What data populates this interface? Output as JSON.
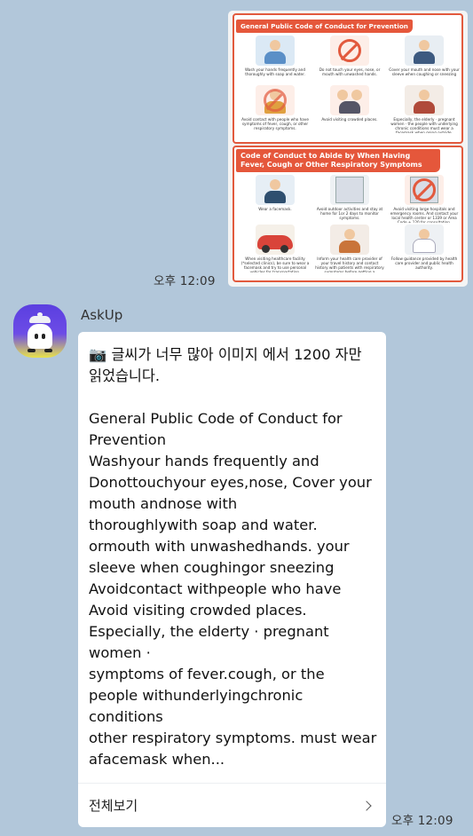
{
  "sent_image": {
    "panel1_title": "General Public Code of Conduct for Prevention",
    "panel1_captions": [
      "Wash your hands frequently and thoroughly with soap and water.",
      "Do not touch your eyes, nose, or mouth with unwashed hands.",
      "Cover your mouth and nose with your sleeve when coughing or sneezing",
      "Avoid contact with people who have symptoms of fever, cough, or other respiratory symptoms.",
      "Avoid visiting crowded places.",
      "Especially, the elderly · pregnant women · the people with underlying chronic conditions must wear a facemask when going outside."
    ],
    "panel2_title": "Code of Conduct to Abide by When Having Fever, Cough or Other Respiratory Symptoms",
    "panel2_captions": [
      "Wear a facemask.",
      "Avoid outdoor activities and stay at home for 1or 2 days to monitor symptoms.",
      "Avoid visiting large hospitals and emergency rooms. And contact your local health center or 1339 or Area Code + 120 for consultation.",
      "When visiting healthcare facility (*selected clinics), be sure to wear a facemask and try to use personal vehicles for transportation.",
      "Inform your health care provider of your travel history and contact history with patients with respiratory symptoms before getting a consultation.",
      "Follow guidance provided by health care provider and public health authority."
    ],
    "time": "오후 12:09"
  },
  "bot": {
    "name": "AskUp",
    "message": "📷 글씨가 너무 많아 이미지 에서 1200 자만 읽었습니다.\n\nGeneral Public Code of Conduct for Prevention\nWashyour hands frequently and\nDonottouchyour eyes,nose, Cover your mouth andnose with\nthoroughlywith soap and water.\normouth with unwashedhands. your\nsleeve when coughingor sneezing\nAvoidcontact withpeople who have\nAvoid visiting crowded places.\nEspecially, the elderty · pregnant women ·\nsymptoms of fever.cough, or the\npeople withunderlyingchronic conditions\nother respiratory symptoms. must wear afacemask when...",
    "view_all": "전체보기",
    "time": "오후 12:09"
  },
  "colors": {
    "background": "#b2c7da",
    "poster_red": "#e5573b",
    "bubble": "#ffffff"
  }
}
